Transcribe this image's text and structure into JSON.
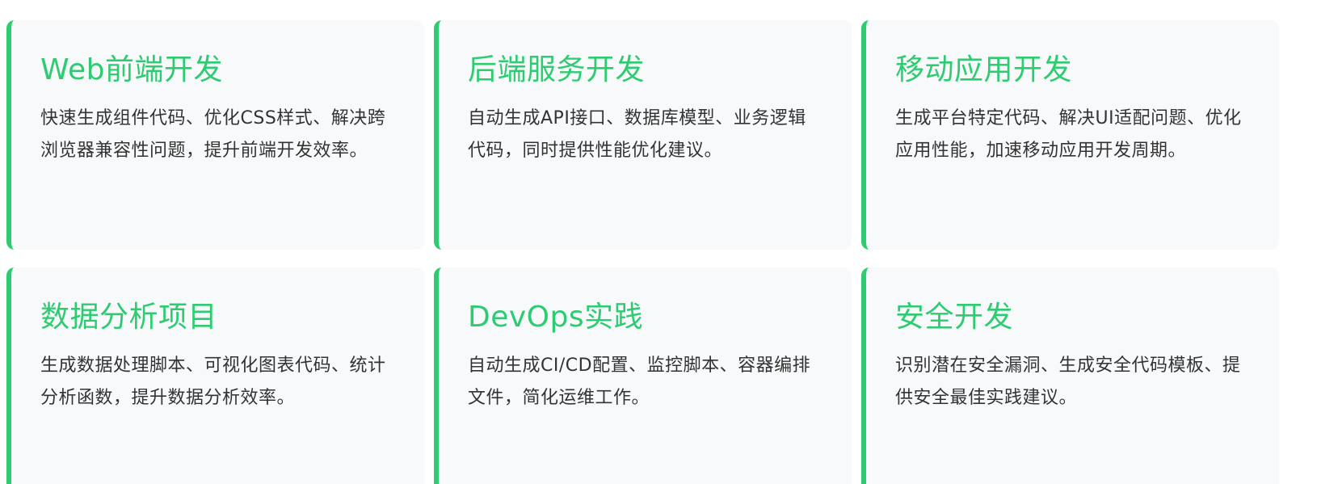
{
  "theme": {
    "accent": "#2ecc71",
    "card_background": "#f7f9fb",
    "text": "#333333"
  },
  "cards": [
    {
      "title": "Web前端开发",
      "description": "快速生成组件代码、优化CSS样式、解决跨浏览器兼容性问题，提升前端开发效率。"
    },
    {
      "title": "后端服务开发",
      "description": "自动生成API接口、数据库模型、业务逻辑代码，同时提供性能优化建议。"
    },
    {
      "title": "移动应用开发",
      "description": "生成平台特定代码、解决UI适配问题、优化应用性能，加速移动应用开发周期。"
    },
    {
      "title": "数据分析项目",
      "description": "生成数据处理脚本、可视化图表代码、统计分析函数，提升数据分析效率。"
    },
    {
      "title": "DevOps实践",
      "description": "自动生成CI/CD配置、监控脚本、容器编排文件，简化运维工作。"
    },
    {
      "title": "安全开发",
      "description": "识别潜在安全漏洞、生成安全代码模板、提供安全最佳实践建议。"
    }
  ]
}
